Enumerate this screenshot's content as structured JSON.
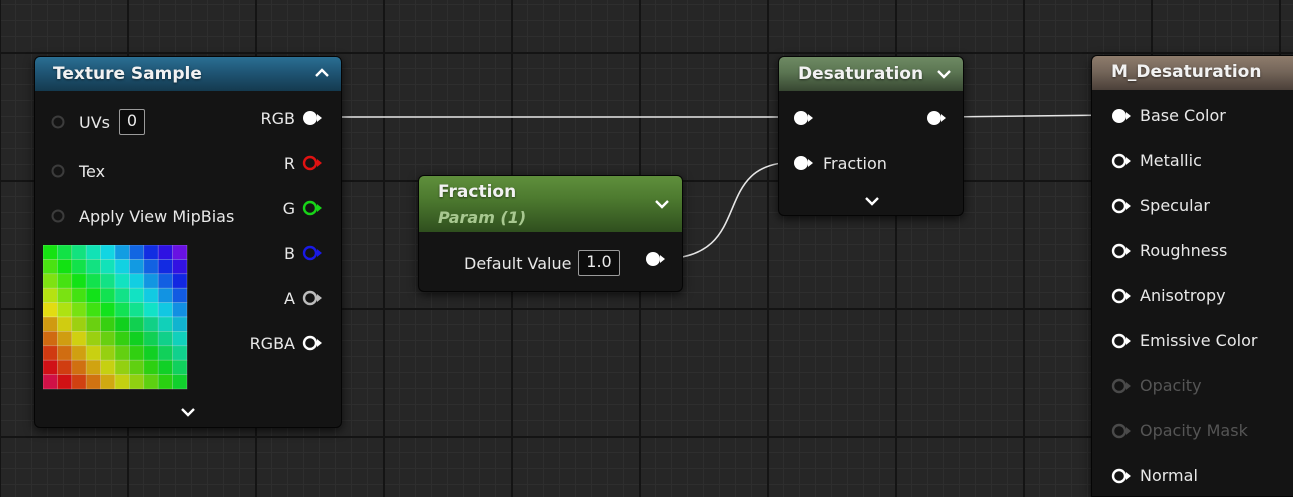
{
  "texture_sample": {
    "title": "Texture Sample",
    "inputs": [
      {
        "label": "UVs",
        "value": "0"
      },
      {
        "label": "Tex"
      },
      {
        "label": "Apply View MipBias"
      }
    ],
    "outputs": [
      {
        "label": "RGB",
        "color": "#ffffff",
        "connected": true
      },
      {
        "label": "R",
        "color": "#e01212"
      },
      {
        "label": "G",
        "color": "#18d418"
      },
      {
        "label": "B",
        "color": "#1a1ae6"
      },
      {
        "label": "A",
        "color": "#bdbdbd"
      },
      {
        "label": "RGBA",
        "color": "#ffffff"
      }
    ],
    "collapse_icon": "chevron-up-icon",
    "expand_icon": "chevron-down-icon"
  },
  "fraction_param": {
    "title": "Fraction",
    "subtitle": "Param (1)",
    "default_value_label": "Default Value",
    "default_value": "1.0",
    "header_color": "#5a8a3a"
  },
  "desaturation": {
    "title": "Desaturation",
    "inputs": [
      {
        "label": ""
      },
      {
        "label": "Fraction"
      }
    ],
    "header_color": "#627c5a"
  },
  "material_result": {
    "title": "M_Desaturation",
    "header_color": "#7a6a5c",
    "inputs": [
      {
        "label": "Base Color",
        "connected": true,
        "enabled": true
      },
      {
        "label": "Metallic",
        "enabled": true
      },
      {
        "label": "Specular",
        "enabled": true
      },
      {
        "label": "Roughness",
        "enabled": true
      },
      {
        "label": "Anisotropy",
        "enabled": true
      },
      {
        "label": "Emissive Color",
        "enabled": true
      },
      {
        "label": "Opacity",
        "enabled": false
      },
      {
        "label": "Opacity Mask",
        "enabled": false
      },
      {
        "label": "Normal",
        "enabled": true
      }
    ]
  },
  "colors": {
    "graph_background": "#262626",
    "wire": "#e6e6e6",
    "disabled_text": "#555555"
  }
}
